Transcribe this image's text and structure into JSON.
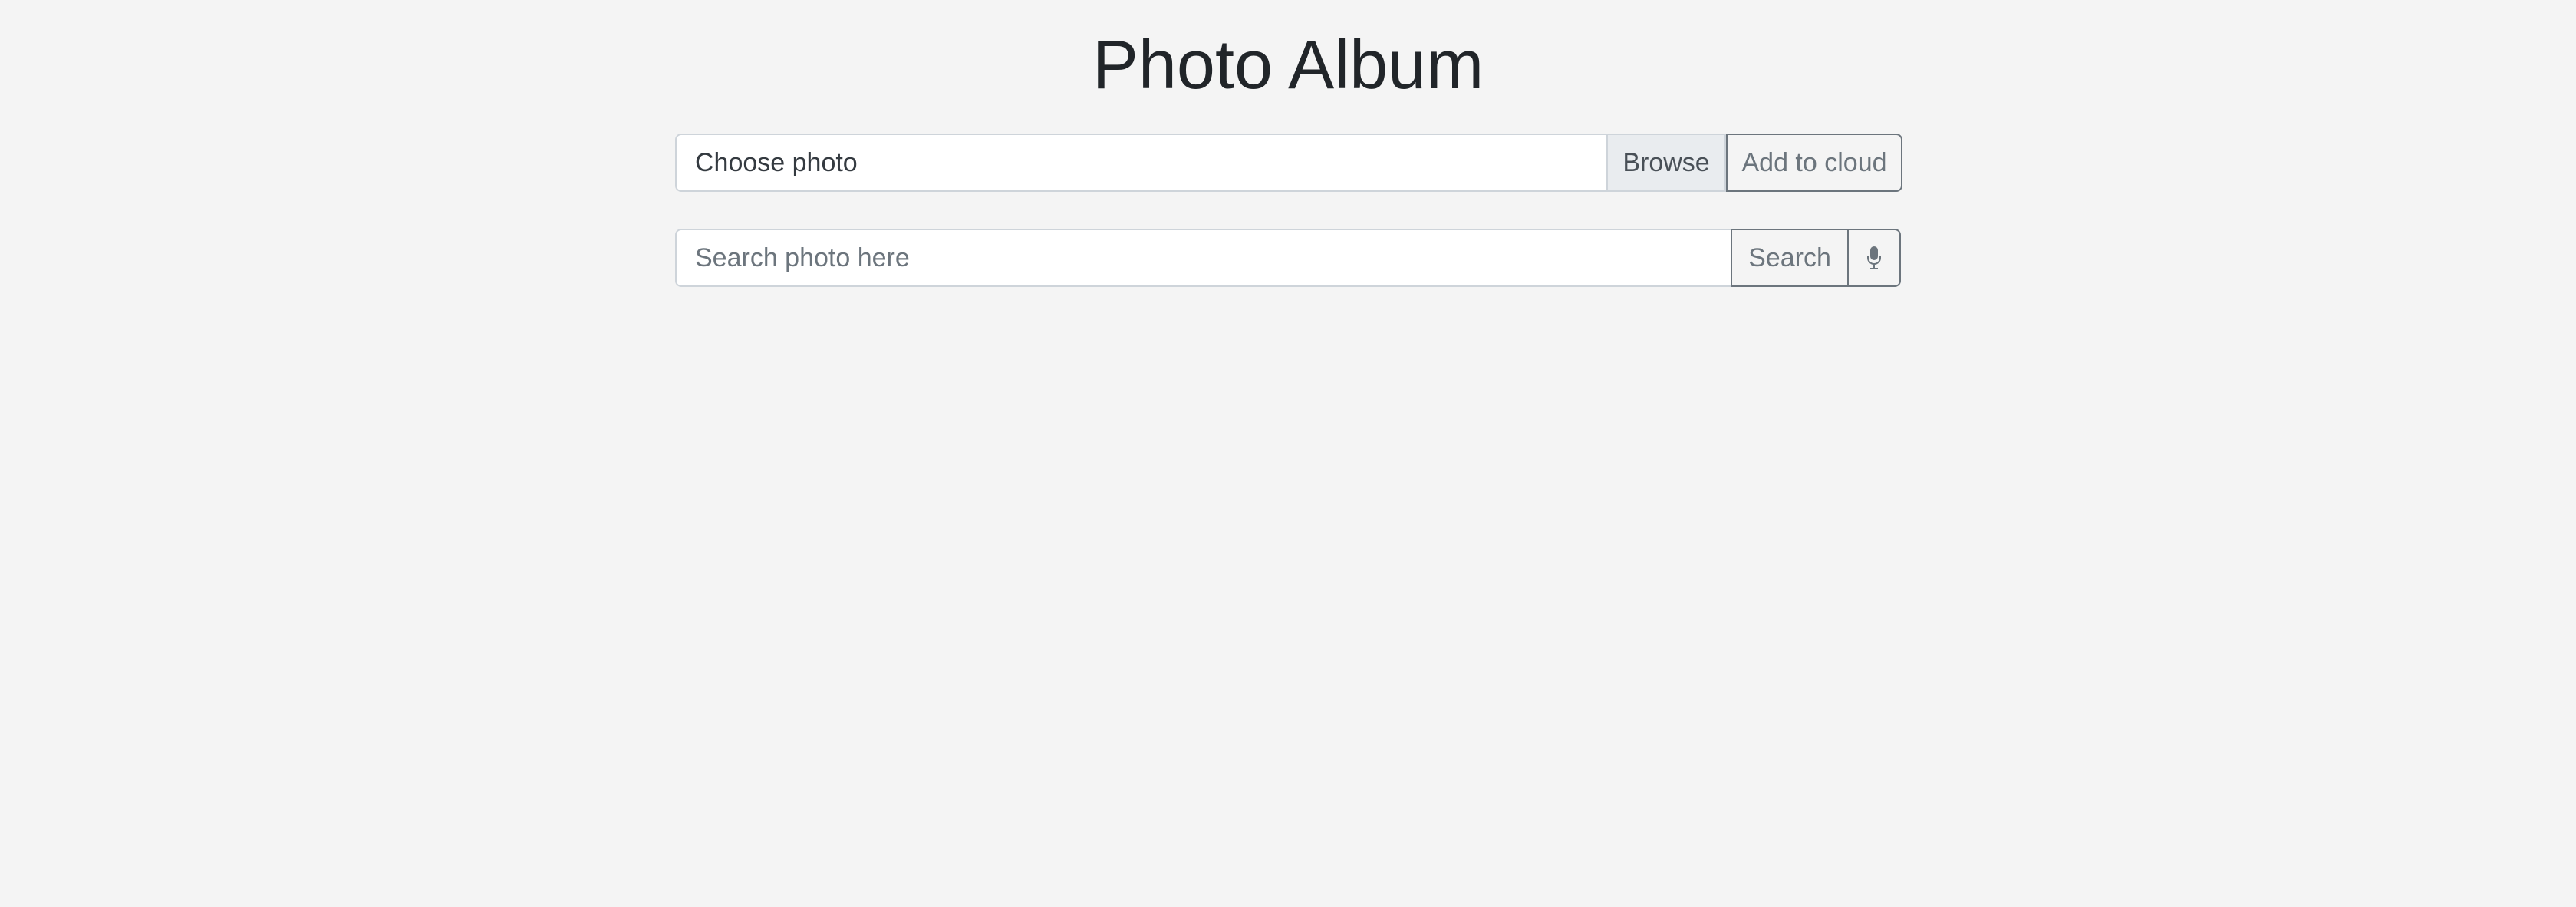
{
  "header": {
    "title": "Photo Album"
  },
  "upload": {
    "file_label": "Choose photo",
    "browse_label": "Browse",
    "add_label": "Add to cloud"
  },
  "search": {
    "placeholder": "Search photo here",
    "value": "",
    "button_label": "Search",
    "voice_icon": "microphone-icon"
  },
  "colors": {
    "background": "#f4f4f4",
    "text": "#212529",
    "outline_button": "#6c757d",
    "input_border": "#ced4da",
    "browse_background": "#e9ecef"
  }
}
